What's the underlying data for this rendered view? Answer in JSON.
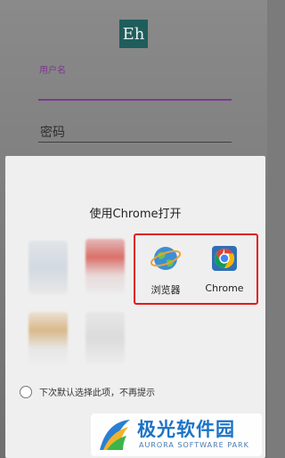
{
  "login": {
    "logo_text": "Eh",
    "username_label": "用户名",
    "password_placeholder": "密码"
  },
  "chooser": {
    "title": "使用Chrome打开",
    "apps": [
      {
        "label": "浏览器",
        "icon": "globe-browser-icon"
      },
      {
        "label": "Chrome",
        "icon": "chrome-icon"
      }
    ],
    "remember_label": "下次默认选择此项，不再提示"
  },
  "watermark": {
    "name": "极光软件园",
    "subtitle": "AURORA SOFTWARE PARK"
  },
  "colors": {
    "highlight": "#e21b1b",
    "accent_purple": "#7a3b8c",
    "watermark_blue": "#1b73c7"
  }
}
